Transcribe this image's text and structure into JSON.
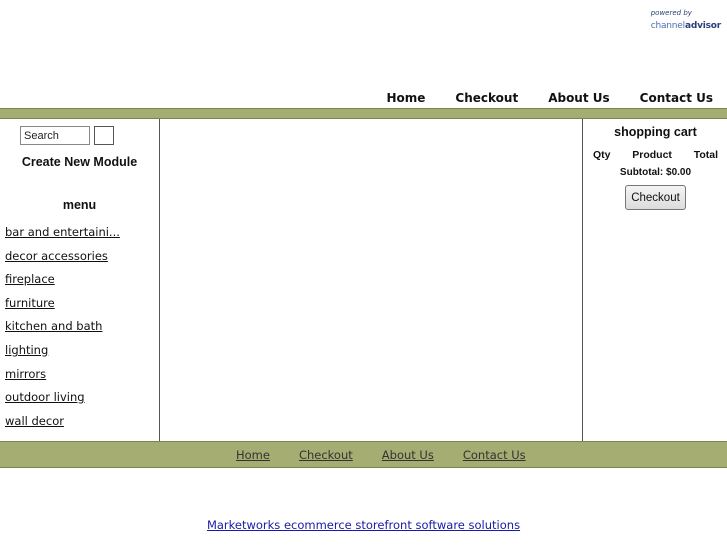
{
  "logo": {
    "powered_by": "powered by",
    "brand_channel": "channel",
    "brand_advisor": "advisor"
  },
  "top_nav": [
    "Home",
    "Checkout",
    "About Us",
    "Contact Us"
  ],
  "search": {
    "placeholder": "Search"
  },
  "create_module": "Create New Module",
  "menu": {
    "title": "menu",
    "items": [
      "bar and entertaini...",
      "decor accessories",
      "fireplace",
      "furniture",
      "kitchen and bath",
      "lighting",
      "mirrors",
      "outdoor living",
      "wall decor"
    ]
  },
  "cart": {
    "title": "shopping cart",
    "columns": [
      "Qty",
      "Product",
      "Total"
    ],
    "subtotal": "Subtotal: $0.00",
    "checkout_label": "Checkout"
  },
  "bottom_nav": [
    "Home",
    "Checkout",
    "About Us",
    "Contact Us"
  ],
  "footer_link": "Marketworks ecommerce storefront software solutions",
  "colors": {
    "nav_bar": "#a5ad73",
    "footer_link": "#1a1aa6"
  }
}
